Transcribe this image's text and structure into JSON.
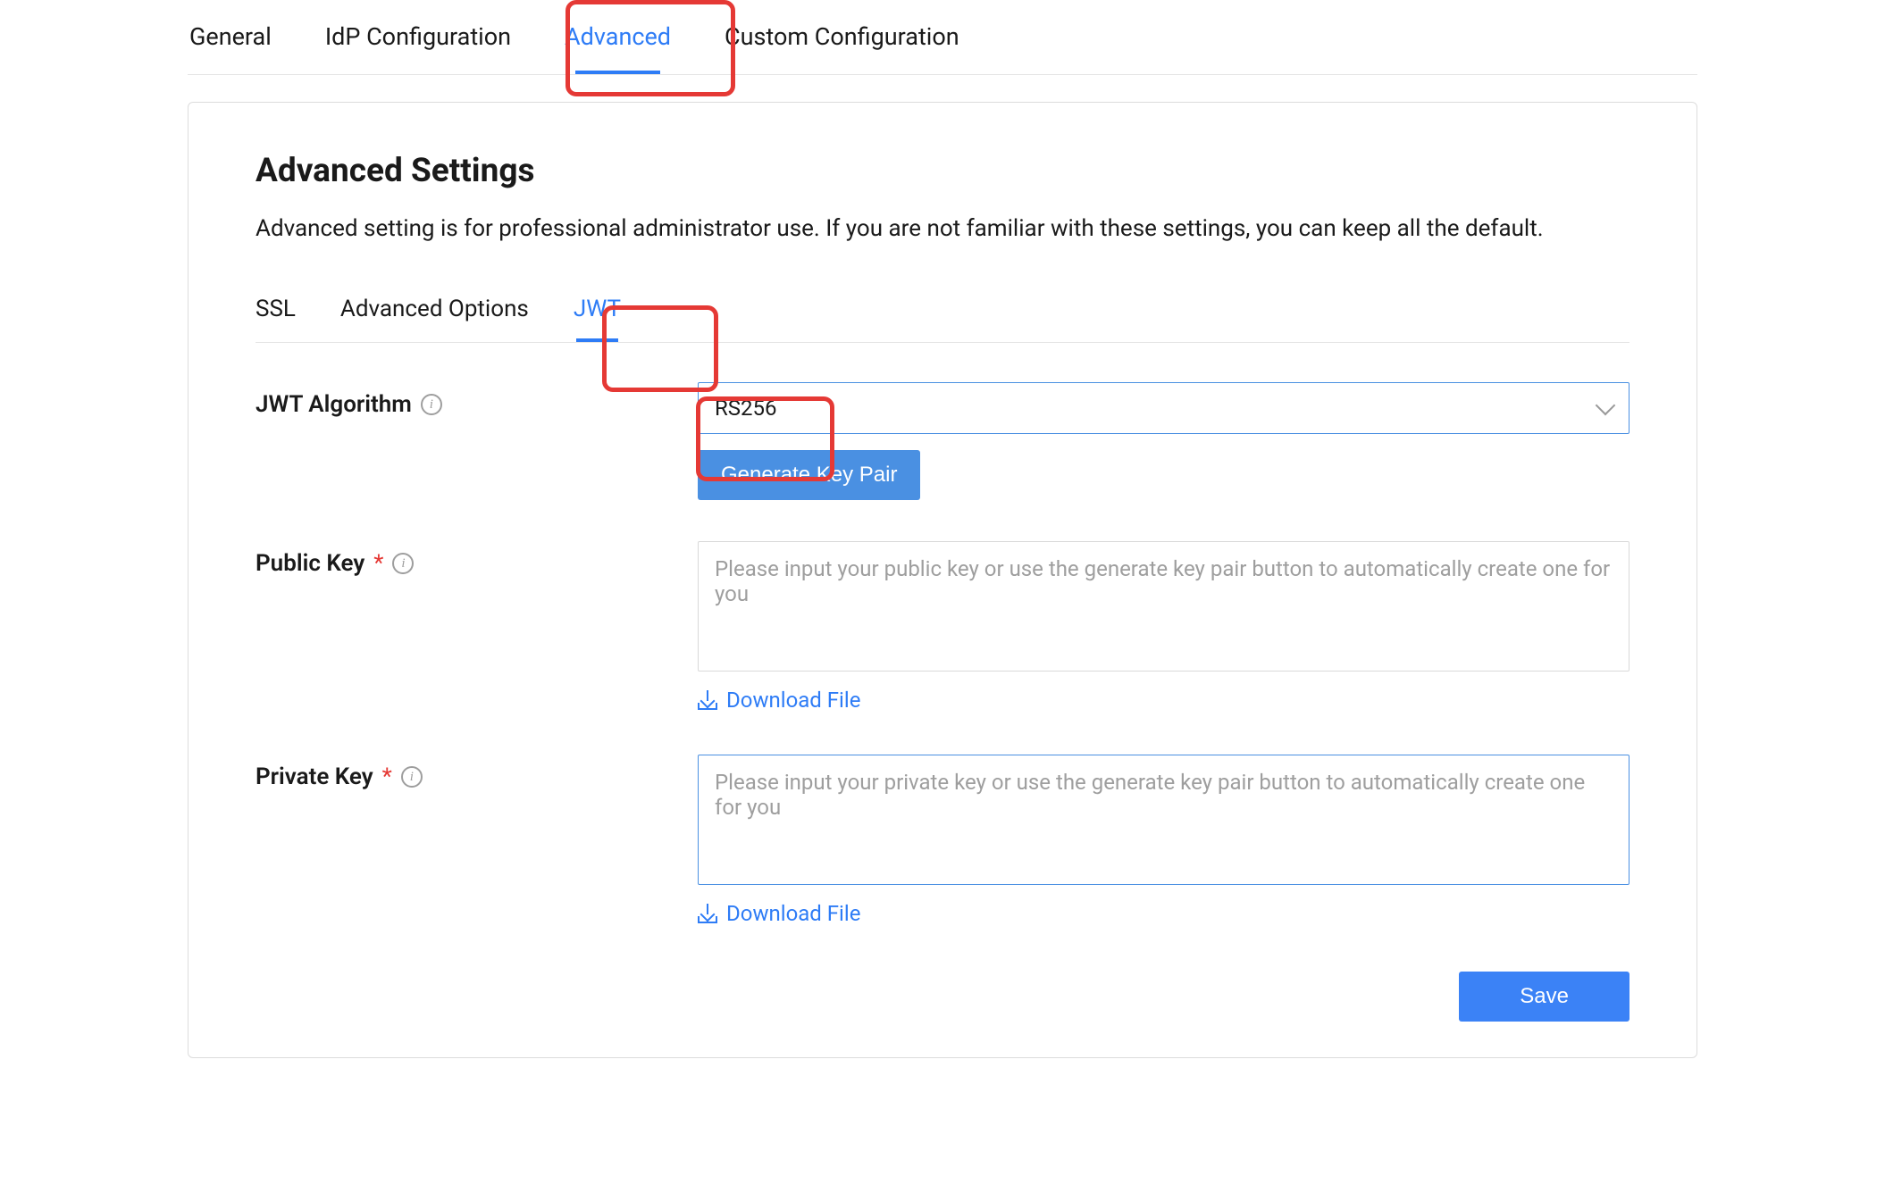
{
  "topnav": {
    "items": [
      {
        "label": "General"
      },
      {
        "label": "IdP Configuration"
      },
      {
        "label": "Advanced",
        "active": true
      },
      {
        "label": "Custom Configuration"
      }
    ]
  },
  "panel": {
    "title": "Advanced Settings",
    "description": "Advanced setting is for professional administrator use. If you are not familiar with these settings, you can keep all the default."
  },
  "subtabs": {
    "items": [
      {
        "label": "SSL"
      },
      {
        "label": "Advanced Options"
      },
      {
        "label": "JWT",
        "active": true
      }
    ]
  },
  "form": {
    "jwt_algorithm": {
      "label": "JWT Algorithm",
      "value": "RS256"
    },
    "generate_button": "Generate Key Pair",
    "public_key": {
      "label": "Public Key",
      "required_mark": "*",
      "placeholder": "Please input your public key or use the generate key pair button to automatically create one for you",
      "download": "Download File"
    },
    "private_key": {
      "label": "Private Key",
      "required_mark": "*",
      "placeholder": "Please input your private key or use the generate key pair button to automatically create one for you",
      "download": "Download File"
    },
    "save_button": "Save"
  },
  "colors": {
    "accent": "#2e7cf6",
    "highlight": "#e53935",
    "button": "#4a90e2"
  }
}
